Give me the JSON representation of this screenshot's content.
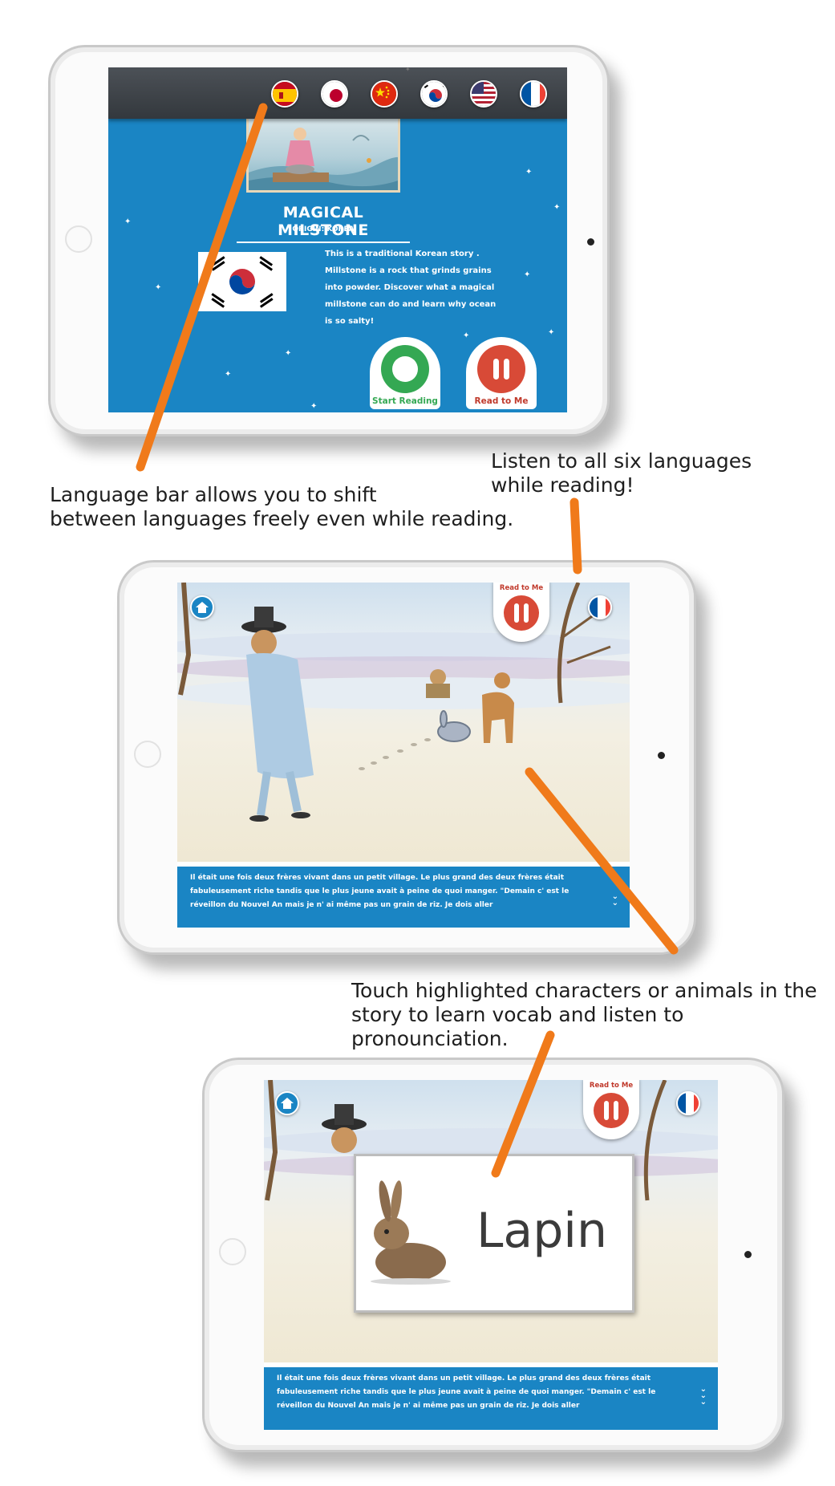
{
  "screen1": {
    "languages": [
      {
        "name": "spanish-flag-icon"
      },
      {
        "name": "japanese-flag-icon"
      },
      {
        "name": "chinese-flag-icon"
      },
      {
        "name": "korean-flag-icon"
      },
      {
        "name": "us-flag-icon"
      },
      {
        "name": "french-flag-icon"
      }
    ],
    "title": "MAGICAL MILSTONE",
    "origin": "ORIGIN: KOREA",
    "description": "This is a traditional Korean story . Millstone is a rock that grinds grains into powder. Discover what a magical millstone can do and learn why ocean is so salty!",
    "start_reading_label": "Start Reading",
    "read_to_me_label": "Read to Me"
  },
  "screen2": {
    "read_to_me_label": "Read to Me",
    "story_text": "Il était une fois deux frères vivant dans un petit village. Le plus grand des deux frères était fabuleusement riche tandis que le plus jeune avait à peine de quoi manger. \"Demain c' est le réveillon du Nouvel An mais je n' ai même pas un grain de riz. Je dois aller"
  },
  "screen3": {
    "read_to_me_label": "Read to Me",
    "vocab_word": "Lapin",
    "story_text": "Il était une fois deux frères vivant dans un petit village. Le plus grand des deux frères était fabuleusement riche tandis que le plus jeune avait à peine de quoi manger. \"Demain c' est le réveillon du Nouvel An mais je n' ai même pas un grain de riz. Je dois aller"
  },
  "annotations": {
    "language_bar": "Language bar allows you to shift\nbetween languages freely even while reading.",
    "listen_all": "Listen to all six languages\nwhile reading!",
    "touch_characters": "Touch highlighted characters or animals in the\nstory to learn vocab and listen to pronounciation."
  },
  "colors": {
    "screen_blue": "#1a85c4",
    "pointer_orange": "#f07a1a",
    "start_green": "#34a853",
    "pause_red": "#d84a37"
  }
}
